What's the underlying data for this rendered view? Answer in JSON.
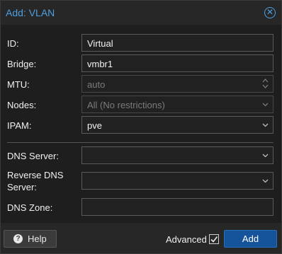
{
  "dialog": {
    "title": "Add: VLAN",
    "close_icon": "close-circle-icon"
  },
  "form": {
    "id": {
      "label": "ID:",
      "value": "Virtual"
    },
    "bridge": {
      "label": "Bridge:",
      "value": "vmbr1"
    },
    "mtu": {
      "label": "MTU:",
      "placeholder": "auto"
    },
    "nodes": {
      "label": "Nodes:",
      "value": "All (No restrictions)"
    },
    "ipam": {
      "label": "IPAM:",
      "value": "pve"
    },
    "dns_server": {
      "label": "DNS Server:",
      "value": ""
    },
    "reverse_dns_server": {
      "label_line1": "Reverse DNS",
      "label_line2": "Server:",
      "value": ""
    },
    "dns_zone": {
      "label": "DNS Zone:",
      "value": ""
    }
  },
  "footer": {
    "help_label": "Help",
    "help_icon": "question-circle-icon",
    "advanced_label": "Advanced",
    "advanced_checked": true,
    "add_label": "Add"
  },
  "colors": {
    "accent": "#4f9fe0",
    "primary_button": "#15549a",
    "background": "#1e1e1e"
  }
}
